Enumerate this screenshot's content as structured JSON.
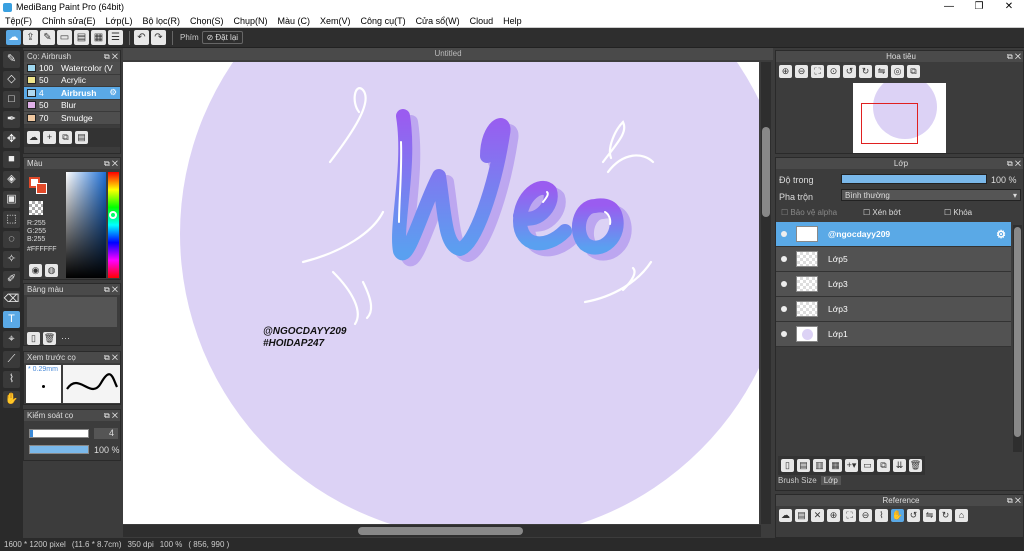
{
  "window": {
    "title": "MediBang Paint Pro (64bit)",
    "minimize": "—",
    "maximize": "❐",
    "close": "✕"
  },
  "menu": [
    "Tệp(F)",
    "Chỉnh sửa(E)",
    "Lớp(L)",
    "Bộ lọc(R)",
    "Chọn(S)",
    "Chụp(N)",
    "Màu (C)",
    "Xem(V)",
    "Công cụ(T)",
    "Cửa sổ(W)",
    "Cloud",
    "Help"
  ],
  "toolbar": {
    "shortcut_label": "Phím",
    "reset_label": "Đặt lại"
  },
  "brush_panel": {
    "title": "Cọ: Airbrush",
    "items": [
      {
        "size": "100",
        "name": "Watercolor (V",
        "color": "#9fd8f0"
      },
      {
        "size": "50",
        "name": "Acrylic",
        "color": "#f0e68c"
      },
      {
        "size": "4",
        "name": "Airbrush",
        "color": "#b0d8f0"
      },
      {
        "size": "50",
        "name": "Blur",
        "color": "#e0b0e8"
      },
      {
        "size": "70",
        "name": "Smudge",
        "color": "#f0c8a0"
      }
    ],
    "selected_index": 2
  },
  "color_panel": {
    "title": "Màu",
    "r": "R:255",
    "g": "G:255",
    "b": "B:255",
    "hex": "#FFFFFF"
  },
  "palette_panel": {
    "title": "Bảng màu",
    "dots": "···"
  },
  "brush_preview": {
    "title": "Xem trước cọ",
    "size": "0.29mm"
  },
  "brush_control": {
    "title": "Kiểm soát cọ",
    "size_value": "4",
    "opacity_value": "100 %"
  },
  "canvas": {
    "tab": "Untitled",
    "word": "Weo",
    "signature1": "@NGOCDAYY209",
    "signature2": "#HOIDAP247",
    "bg_color": "#dcd2f5"
  },
  "navigator": {
    "title": "Hoa tiêu"
  },
  "layer_panel": {
    "title": "Lớp",
    "opacity_label": "Độ trong",
    "opacity_value": "100 %",
    "opacity_fraction": 1.0,
    "blend_label": "Pha trộn",
    "blend_value": "Bình thường",
    "protect_alpha": "Bảo vệ alpha",
    "clipping": "Xén bớt",
    "lock": "Khóa",
    "layers": [
      "@ngocdayy209",
      "Lớp5",
      "Lớp3",
      "Lớp3",
      "Lớp1"
    ],
    "selected_index": 0
  },
  "bottom_tabs": [
    "Brush Size",
    "Lớp"
  ],
  "reference_panel": {
    "title": "Reference"
  },
  "status": {
    "dims": "1600 * 1200 pixel",
    "physical": "(11.6 * 8.7cm)",
    "dpi": "350 dpi",
    "zoom": "100 %",
    "coords": "( 856, 990 )"
  }
}
